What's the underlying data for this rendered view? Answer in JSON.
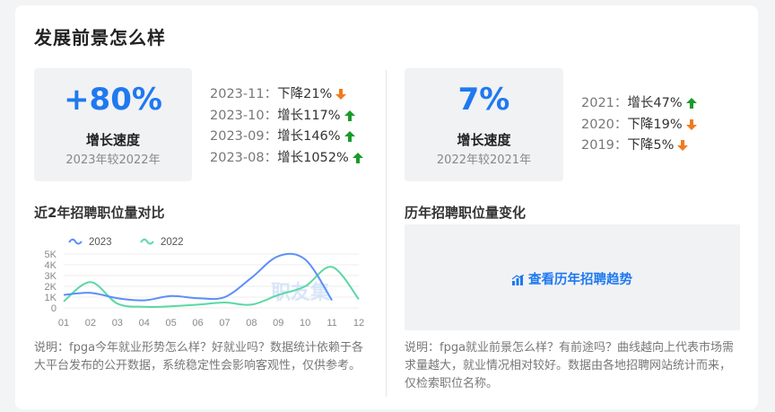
{
  "title": "发展前景怎么样",
  "left_stat": {
    "value": "+80%",
    "label": "增长速度",
    "sub": "2023年较2022年"
  },
  "left_trend": [
    {
      "period": "2023-11：",
      "text": "下降21%",
      "dir": "down"
    },
    {
      "period": "2023-10：",
      "text": "增长117%",
      "dir": "up"
    },
    {
      "period": "2023-09：",
      "text": "增长146%",
      "dir": "up"
    },
    {
      "period": "2023-08：",
      "text": "增长1052%",
      "dir": "up"
    }
  ],
  "right_stat": {
    "value": "7%",
    "label": "增长速度",
    "sub": "2022年较2021年"
  },
  "right_trend": [
    {
      "period": "2021：",
      "text": "增长47%",
      "dir": "up"
    },
    {
      "period": "2020：",
      "text": "下降19%",
      "dir": "down"
    },
    {
      "period": "2019：",
      "text": "下降5%",
      "dir": "down"
    }
  ],
  "left_section": "近2年招聘职位量对比",
  "right_section": "历年招聘职位量变化",
  "trend_button": "查看历年招聘趋势",
  "watermark": "职友集",
  "left_note": "说明：fpga今年就业形势怎么样？好就业吗？数据统计依赖于各大平台发布的公开数据，系统稳定性会影响客观性，仅供参考。",
  "right_note": "说明：fpga就业前景怎么样？有前途吗？曲线越向上代表市场需求量越大，就业情况相对较好。数据由各地招聘网站统计而来，仅检索职位名称。",
  "colors": {
    "accent": "#1f79f0",
    "up": "#1a9a2a",
    "down": "#f07b1f",
    "series_2023": "#5b8ff9",
    "series_2022": "#5ad8a6"
  },
  "chart_data": {
    "type": "line",
    "categories": [
      "01",
      "02",
      "03",
      "04",
      "05",
      "06",
      "07",
      "08",
      "09",
      "10",
      "11",
      "12"
    ],
    "ylim": [
      0,
      5000
    ],
    "yticks": [
      "0",
      "1K",
      "2K",
      "3K",
      "4K",
      "5K"
    ],
    "legend": "top-left",
    "grid": true,
    "series": [
      {
        "name": "2023",
        "color": "#5b8ff9",
        "values": [
          1200,
          1400,
          900,
          700,
          1100,
          900,
          1000,
          2800,
          4800,
          4500,
          700,
          null
        ]
      },
      {
        "name": "2022",
        "color": "#5ad8a6",
        "values": [
          600,
          2400,
          400,
          100,
          150,
          300,
          500,
          300,
          1200,
          2000,
          3800,
          800
        ]
      }
    ]
  }
}
